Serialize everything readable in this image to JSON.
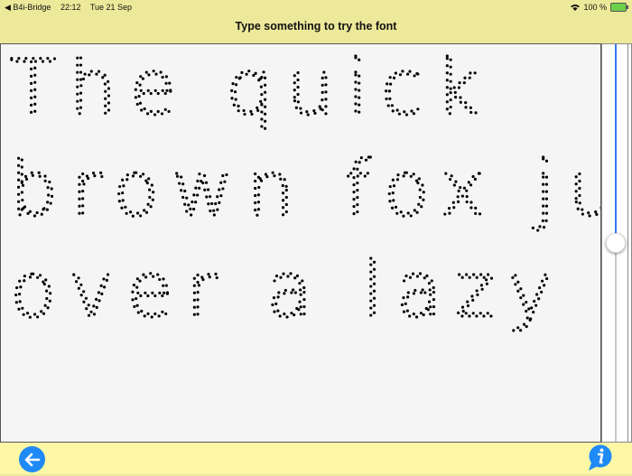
{
  "status_bar": {
    "back_app": "◀ B4i-Bridge",
    "time": "22:12",
    "date": "Tue 21 Sep",
    "battery": "100 %"
  },
  "header": {
    "title": "Type something to try the font"
  },
  "editor": {
    "text": "The quick brown fox jumps over a lazy dog."
  },
  "font_size_slider": {
    "value": 0.5
  },
  "colors": {
    "accent": "#1f8af5",
    "header_bg": "#ede99a",
    "footer_bg": "#fdf7a6"
  },
  "footer": {
    "back_icon": "arrow-left-icon",
    "info_icon": "info-bubble-icon"
  }
}
